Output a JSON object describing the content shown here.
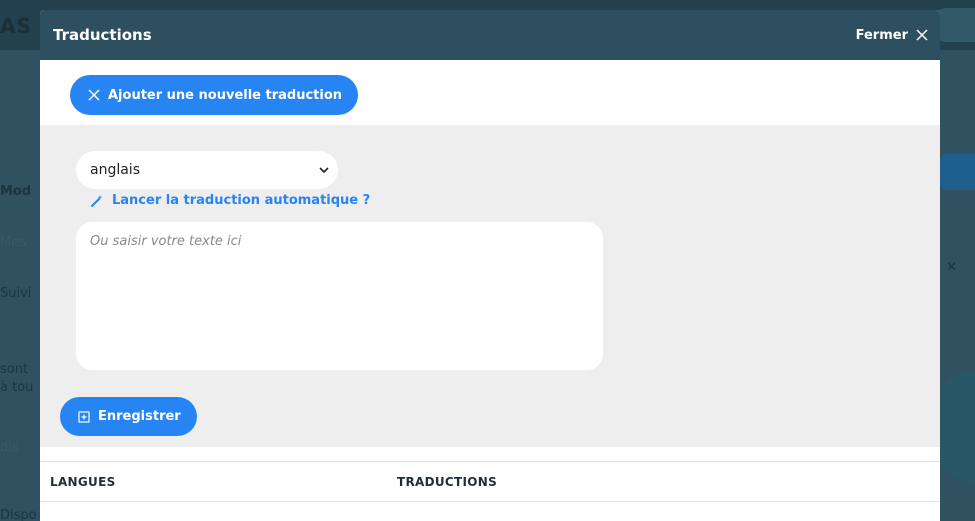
{
  "background": {
    "title_fragment": "AS A",
    "text_1": "Mod",
    "text_2": "Mes",
    "text_3": "Suivi",
    "text_4": "sont",
    "text_5": "à tou",
    "text_6": "dis",
    "text_7": "Dispo"
  },
  "modal": {
    "title": "Traductions",
    "close_label": "Fermer"
  },
  "toolbar": {
    "add_translation_label": "Ajouter une nouvelle traduction"
  },
  "form": {
    "language_selected": "anglais",
    "auto_translate_label": "Lancer la traduction automatique ?",
    "text_placeholder": "Ou saisir votre texte ici",
    "save_label": "Enregistrer"
  },
  "table": {
    "columns": [
      "LANGUES",
      "TRADUCTIONS"
    ]
  },
  "colors": {
    "accent": "#2785f3",
    "header": "#2d4f5f",
    "form_bg": "#eeeeee"
  }
}
